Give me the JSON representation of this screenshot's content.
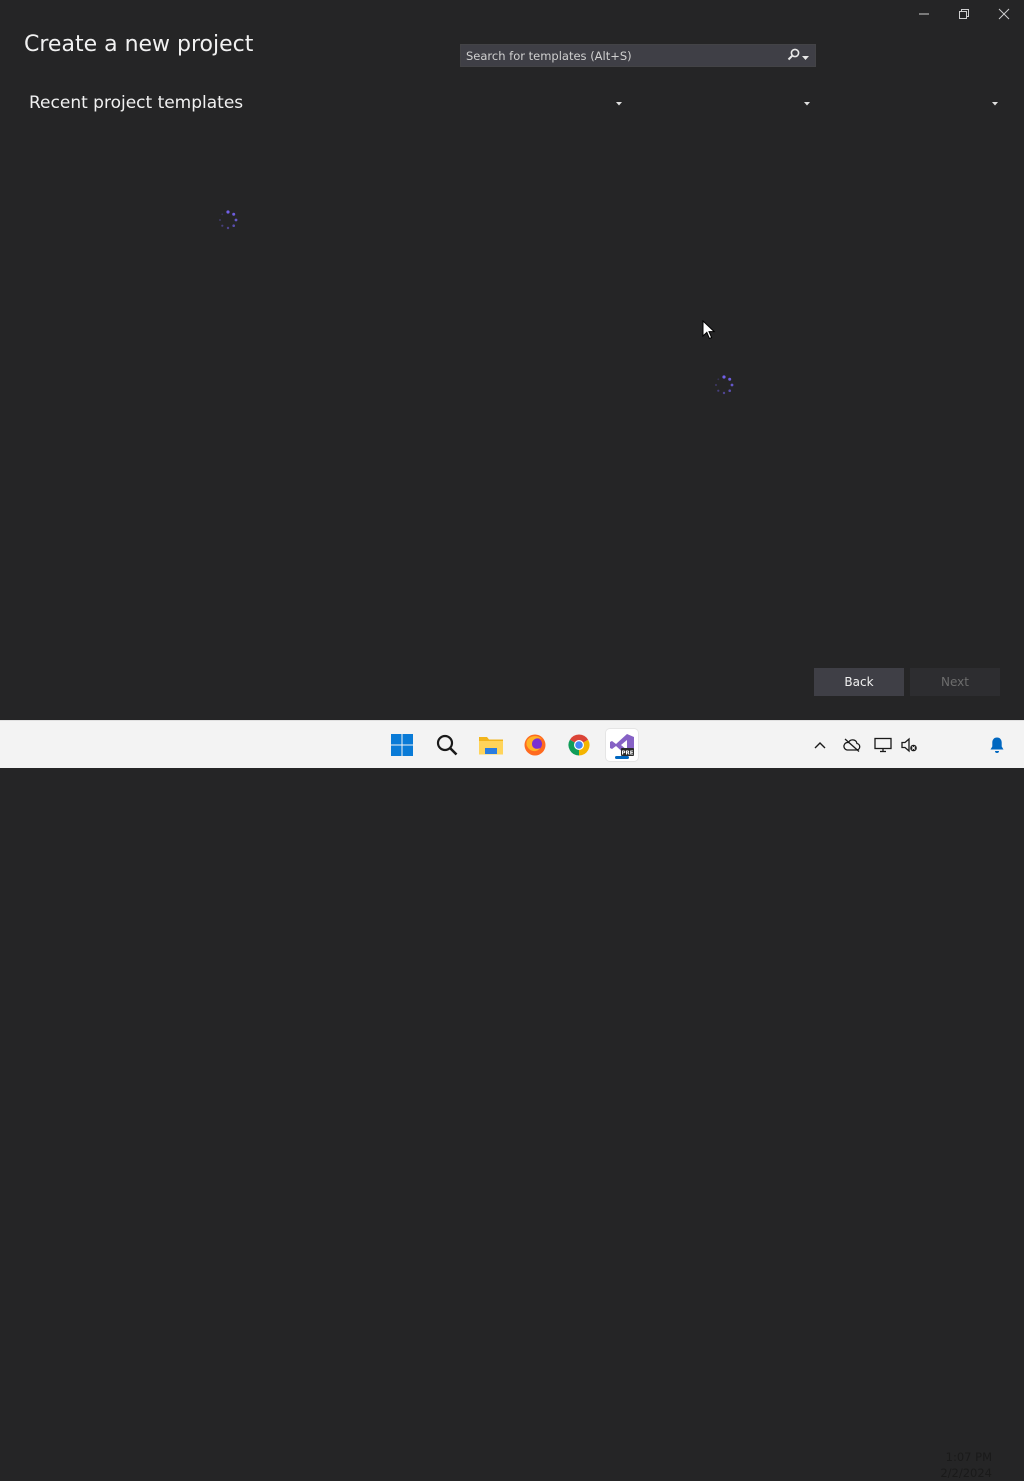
{
  "window": {
    "title": "Create a new project",
    "controls": [
      "minimize-icon",
      "restore-icon",
      "close-icon"
    ]
  },
  "recent": {
    "heading": "Recent project templates"
  },
  "search": {
    "placeholder": "Search for templates (Alt+S)",
    "value": ""
  },
  "filters": [
    {
      "name": "language-filter",
      "value": ""
    },
    {
      "name": "platform-filter",
      "value": ""
    },
    {
      "name": "project-type-filter",
      "value": ""
    }
  ],
  "footer": {
    "back_label": "Back",
    "next_label": "Next"
  },
  "taskbar": {
    "apps": [
      "start-icon",
      "search-icon",
      "file-explorer-icon",
      "firefox-icon",
      "chrome-icon",
      "visual-studio-preview-icon"
    ],
    "tray": [
      "chevron-up-icon",
      "onedrive-offline-icon",
      "display-icon",
      "speaker-muted-icon",
      "notification-bell-icon"
    ],
    "time": "1:07 PM",
    "date": "2/2/2024"
  },
  "colors": {
    "background": "#252526",
    "accent": "#0067c0",
    "spinner": "#7160e8"
  }
}
